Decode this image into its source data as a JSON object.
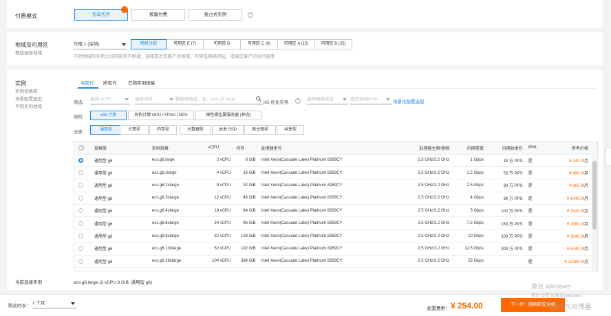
{
  "billing": {
    "label": "付费模式",
    "options": [
      "包年包月",
      "按量付费",
      "抢占式实例"
    ],
    "selected_index": 0
  },
  "region": {
    "label": "地域及可用区",
    "help": "教我选择地域",
    "select_value": "华南 1 (深圳)",
    "zones": [
      "随机分配",
      "可用区 E (7)",
      "可用区 D",
      "可用区 C (6)",
      "可用区 A (15)",
      "可用区 B (25)"
    ],
    "selected_zone_index": 0,
    "note": "不同地域的实例之间内网互不相通；选择靠近您客户的地域，可降低网络时延、提高您客户的访问速度"
  },
  "instance": {
    "label": "实例",
    "help_links": [
      "实例规格族",
      "场景配置选型",
      "可购买的地域"
    ],
    "tabs": [
      "当前代",
      "所有代",
      "已购实例规格"
    ],
    "selected_tab_index": 0,
    "filter_label": "筛选",
    "vcpu_placeholder": "选择 vCPU",
    "mem_placeholder": "选择内存",
    "search_placeholder": "搜索规格名，如：ecs.g5.large",
    "io_label": "I/O 优化实例",
    "net_placeholder": "选择网络类型",
    "ipv6_placeholder": "是否支持IPv6",
    "recommend_link": "场景化配置选型",
    "arch_label": "架构",
    "arch_options": [
      "x86 计算",
      "异构计算 GPU / FPGA / NPU",
      "弹性裸金属服务器 (神龙)"
    ],
    "selected_arch_index": 0,
    "cat_label": "分类",
    "categories": [
      "通用型",
      "计算型",
      "内存型",
      "大数据型",
      "本地 SSD",
      "高主频型",
      "共享型"
    ],
    "selected_cat_index": 0,
    "columns": [
      "规格族",
      "实例规格",
      "vCPU",
      "内存",
      "处理器型号",
      "处理器主频/睿频",
      "内网带宽",
      "内网收发包",
      "IPv6",
      "参考价格"
    ],
    "rows": [
      {
        "family": "通用型 g6",
        "spec": "ecs.g6.large",
        "vcpu": "2 vCPU",
        "mem": "8 GiB",
        "cpu": "Intel Xeon(Cascade Lake) Platinum 8269CY",
        "freq": "2.5 GHz/3.2 GHz",
        "bw": "1 Gbps",
        "pps": "30 万 PPS",
        "ipv6": "是",
        "price": "¥ 240.0",
        "unit": "/月"
      },
      {
        "family": "通用型 g6",
        "spec": "ecs.g6.xlarge",
        "vcpu": "4 vCPU",
        "mem": "16 GiB",
        "cpu": "Intel Xeon(Cascade Lake) Platinum 8269CY",
        "freq": "2.5 GHz/3.2 GHz",
        "bw": "1.5 Gbps",
        "pps": "50 万 PPS",
        "ipv6": "是",
        "price": "¥ 480.0",
        "unit": "/月"
      },
      {
        "family": "通用型 g6",
        "spec": "ecs.g6.2xlarge",
        "vcpu": "8 vCPU",
        "mem": "32 GiB",
        "cpu": "Intel Xeon(Cascade Lake) Platinum 8269CY",
        "freq": "2.5 GHz/3.2 GHz",
        "bw": "2.5 Gbps",
        "pps": "80 万 PPS",
        "ipv6": "是",
        "price": "¥ 960.0",
        "unit": "/月"
      },
      {
        "family": "通用型 g6",
        "spec": "ecs.g6.3xlarge",
        "vcpu": "12 vCPU",
        "mem": "48 GiB",
        "cpu": "Intel Xeon(Cascade Lake) Platinum 8269CY",
        "freq": "2.5 GHz/3.2 GHz",
        "bw": "4 Gbps",
        "pps": "90 万 PPS",
        "ipv6": "是",
        "price": "¥ 1440.0",
        "unit": "/月"
      },
      {
        "family": "通用型 g6",
        "spec": "ecs.g6.4xlarge",
        "vcpu": "16 vCPU",
        "mem": "64 GiB",
        "cpu": "Intel Xeon(Cascade Lake) Platinum 8269CY",
        "freq": "2.5 GHz/3.2 GHz",
        "bw": "5 Gbps",
        "pps": "100 万 PPS",
        "ipv6": "是",
        "price": "¥ 1920.0",
        "unit": "/月"
      },
      {
        "family": "通用型 g6",
        "spec": "ecs.g6.6xlarge",
        "vcpu": "24 vCPU",
        "mem": "96 GiB",
        "cpu": "Intel Xeon(Cascade Lake) Platinum 8269CY",
        "freq": "2.5 GHz/3.2 GHz",
        "bw": "7.5 Gbps",
        "pps": "150 万 PPS",
        "ipv6": "是",
        "price": "¥ 2880.0",
        "unit": "/月"
      },
      {
        "family": "通用型 g6",
        "spec": "ecs.g6.8xlarge",
        "vcpu": "32 vCPU",
        "mem": "128 GiB",
        "cpu": "Intel Xeon(Cascade Lake) Platinum 8269CY",
        "freq": "2.5 GHz/3.2 GHz",
        "bw": "10 Gbps",
        "pps": "200 万 PPS",
        "ipv6": "是",
        "price": "¥ 3840.0",
        "unit": "/月"
      },
      {
        "family": "通用型 g6",
        "spec": "ecs.g6.13xlarge",
        "vcpu": "52 vCPU",
        "mem": "192 GiB",
        "cpu": "Intel Xeon(Cascade Lake) Platinum 8269CY",
        "freq": "2.5 GHz/3.2 GHz",
        "bw": "12.5 Gbps",
        "pps": "300 万 PPS",
        "ipv6": "是",
        "price": "¥ 6240.0",
        "unit": "/月"
      },
      {
        "family": "通用型 g6",
        "spec": "ecs.g6.26xlarge",
        "vcpu": "104 vCPU",
        "mem": "384 GiB",
        "cpu": "Intel Xeon(Cascade Lake) Platinum 8269CY",
        "freq": "2.5 GHz/3.2 GHz",
        "bw": "25 Gbps",
        "pps": "",
        "ipv6": "是",
        "price": "¥ 12480.0",
        "unit": "/月"
      }
    ],
    "selected_row_index": 0,
    "current_label": "当前选择实例",
    "current_value": "ecs.g6.large (2 vCPU 8 GiB, 通用型 g6)"
  },
  "footer": {
    "duration_label": "购买时长：",
    "duration_value": "1 个月",
    "fee_label": "配置费用：",
    "fee_value": "¥ 254.00",
    "next_label": "下一步：网络和安全组"
  },
  "overlay": {
    "activate_title": "激活 Windows",
    "activate_sub": "转到\"设置\"以激活 Windows。",
    "watermark": "@ITPUB博客"
  },
  "colors": {
    "accent": "#1e88e5",
    "price": "#ff6a00",
    "next_button": "#ff6a00"
  }
}
